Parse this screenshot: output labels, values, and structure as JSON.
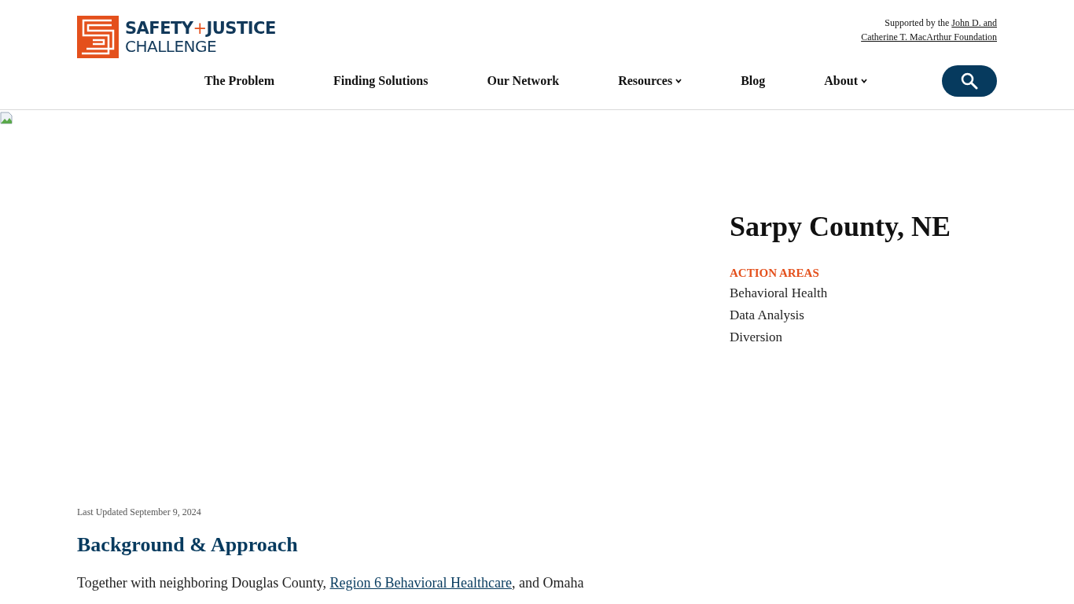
{
  "header": {
    "logo": {
      "line_1": "SAFETY",
      "plus": "+",
      "line_1b": "JUSTICE",
      "line_2": "CHALLENGE"
    },
    "support": {
      "text": "Supported by the",
      "link_1": "John D. and",
      "link_2": "Catherine T. MacArthur Foundation"
    },
    "nav": [
      {
        "label": "The Problem",
        "dropdown": false
      },
      {
        "label": "Finding Solutions",
        "dropdown": false
      },
      {
        "label": "Our Network",
        "dropdown": false
      },
      {
        "label": "Resources",
        "dropdown": true
      },
      {
        "label": "Blog",
        "dropdown": false
      },
      {
        "label": "About",
        "dropdown": true
      }
    ]
  },
  "hero": {
    "title": "Sarpy County, NE",
    "action_areas_heading": "ACTION AREAS",
    "action_areas": [
      "Behavioral Health",
      "Data Analysis",
      "Diversion"
    ]
  },
  "content": {
    "last_updated": "Last Updated September 9, 2024",
    "heading": "Background & Approach",
    "paragraph": {
      "before": "Together with neighboring Douglas County, ",
      "link": "Region 6 Behavioral Healthcare",
      "after": ", and Omaha"
    }
  }
}
